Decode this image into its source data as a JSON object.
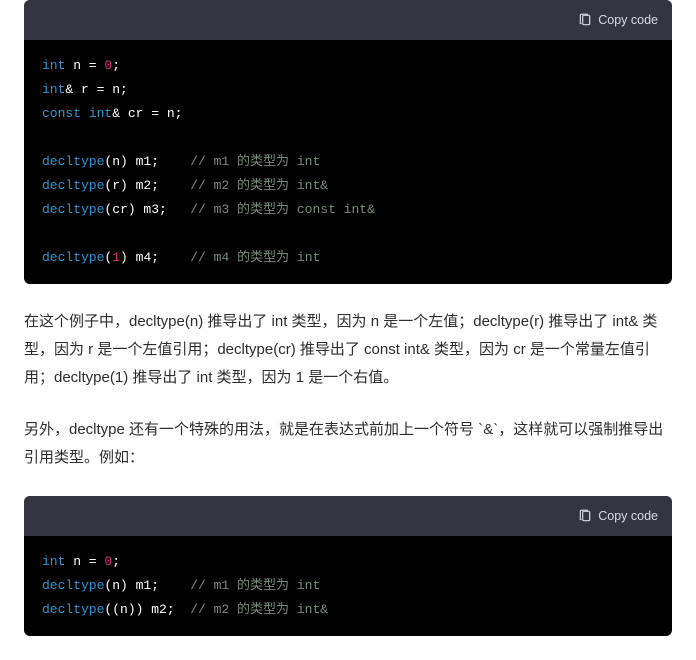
{
  "copy_label": "Copy code",
  "block1": {
    "l1": {
      "kw": "int",
      "rest": " n = ",
      "num": "0",
      "tail": ";"
    },
    "l2": {
      "kw": "int",
      "amp": "& r = n;"
    },
    "l3": {
      "kw1": "const ",
      "kw2": "int",
      "tail": "& cr = n;"
    },
    "l5": {
      "fn": "decltype",
      "args": "(n) m1;",
      "pad": "    ",
      "cm": "// m1 的类型为 int"
    },
    "l6": {
      "fn": "decltype",
      "args": "(r) m2;",
      "pad": "    ",
      "cm": "// m2 的类型为 int&"
    },
    "l7": {
      "fn": "decltype",
      "args": "(cr) m3;",
      "pad": "   ",
      "cm": "// m3 的类型为 const int&"
    },
    "l9": {
      "fn": "decltype",
      "args": "(",
      "num": "1",
      "args2": ") m4;",
      "pad": "    ",
      "cm": "// m4 的类型为 int"
    }
  },
  "para1": "在这个例子中，decltype(n) 推导出了 int 类型，因为 n 是一个左值；decltype(r) 推导出了 int& 类型，因为 r 是一个左值引用；decltype(cr) 推导出了 const int& 类型，因为 cr 是一个常量左值引用；decltype(1) 推导出了 int 类型，因为 1 是一个右值。",
  "para2": "另外，decltype 还有一个特殊的用法，就是在表达式前加上一个符号 `&`，这样就可以强制推导出引用类型。例如：",
  "block2": {
    "l1": {
      "kw": "int",
      "rest": " n = ",
      "num": "0",
      "tail": ";"
    },
    "l2": {
      "fn": "decltype",
      "args": "(n) m1;",
      "pad": "    ",
      "cm": "// m1 的类型为 int"
    },
    "l3": {
      "fn": "decltype",
      "args": "((n)) m2;",
      "pad": "  ",
      "cm": "// m2 的类型为 int&"
    }
  }
}
